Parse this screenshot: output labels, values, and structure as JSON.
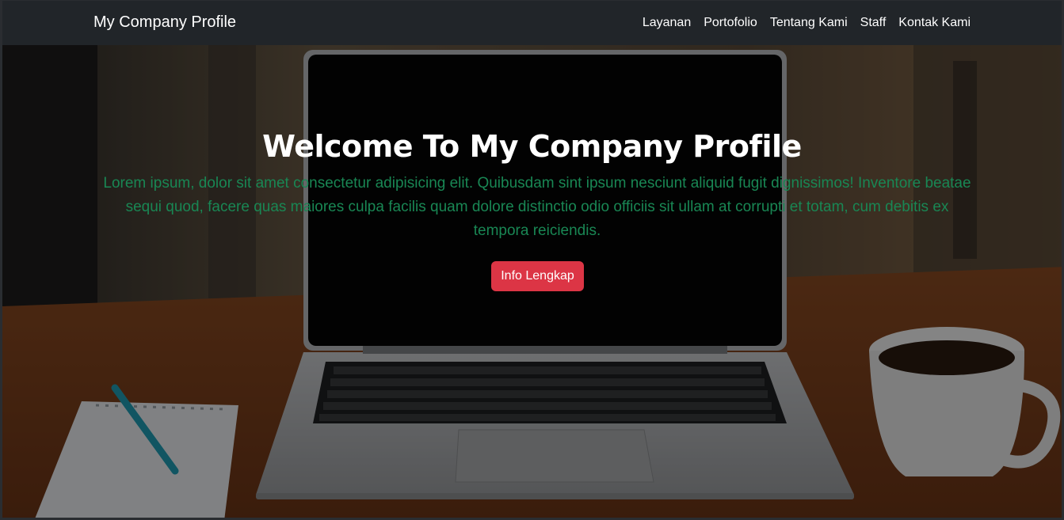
{
  "navbar": {
    "brand": "My Company Profile",
    "links": [
      {
        "label": "Layanan"
      },
      {
        "label": "Portofolio"
      },
      {
        "label": "Tentang Kami"
      },
      {
        "label": "Staff"
      },
      {
        "label": "Kontak Kami"
      }
    ]
  },
  "hero": {
    "title": "Welcome To My Company Profile",
    "text": "Lorem ipsum, dolor sit amet consectetur adipisicing elit. Quibusdam sint ipsum nesciunt aliquid fugit dignissimos! Inventore beatae sequi quod, facere quas maiores culpa facilis quam dolore distinctio odio officiis sit ullam at corrupti et totam, cum debitis ex tempora reiciendis.",
    "button_label": "Info Lengkap",
    "background_image": "laptop-on-desk-photo"
  },
  "colors": {
    "navbar_bg": "#212529",
    "text_green": "#198754",
    "button_red": "#dc3545"
  }
}
